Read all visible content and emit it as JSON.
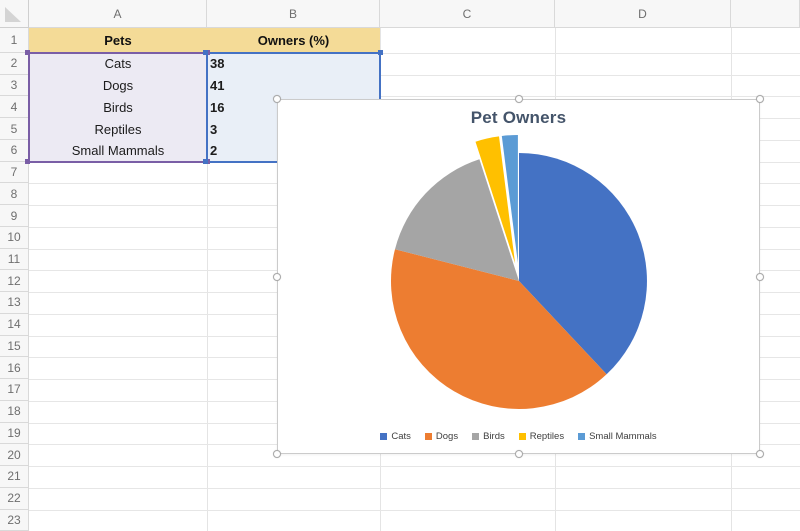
{
  "sheet": {
    "column_letters": [
      "A",
      "B",
      "C",
      "D",
      ""
    ],
    "row_numbers": [
      "1",
      "2",
      "3",
      "4",
      "5",
      "6",
      "7",
      "8",
      "9",
      "10",
      "11",
      "12",
      "13",
      "14",
      "15",
      "16",
      "17",
      "18",
      "19",
      "20",
      "21",
      "22",
      "23"
    ]
  },
  "table": {
    "headers": {
      "pets": "Pets",
      "owners": "Owners (%)"
    },
    "rows": [
      {
        "pet": "Cats",
        "value": "38"
      },
      {
        "pet": "Dogs",
        "value": "41"
      },
      {
        "pet": "Birds",
        "value": "16"
      },
      {
        "pet": "Reptiles",
        "value": "3"
      },
      {
        "pet": "Small Mammals",
        "value": "2"
      }
    ]
  },
  "chart_data": {
    "type": "pie",
    "title": "Pet Owners",
    "categories": [
      "Cats",
      "Dogs",
      "Birds",
      "Reptiles",
      "Small Mammals"
    ],
    "values": [
      38,
      41,
      16,
      3,
      2
    ],
    "colors": [
      "#4472C4",
      "#ED7D31",
      "#A5A5A5",
      "#FFC000",
      "#5B9BD5"
    ],
    "exploded": [
      false,
      false,
      false,
      true,
      true
    ],
    "legend_position": "bottom",
    "title_color": "#44546A"
  },
  "accents": {
    "category_range_border": "#7a5ea6",
    "value_range_border": "#4472C4",
    "header_fill": "#f4db97"
  }
}
